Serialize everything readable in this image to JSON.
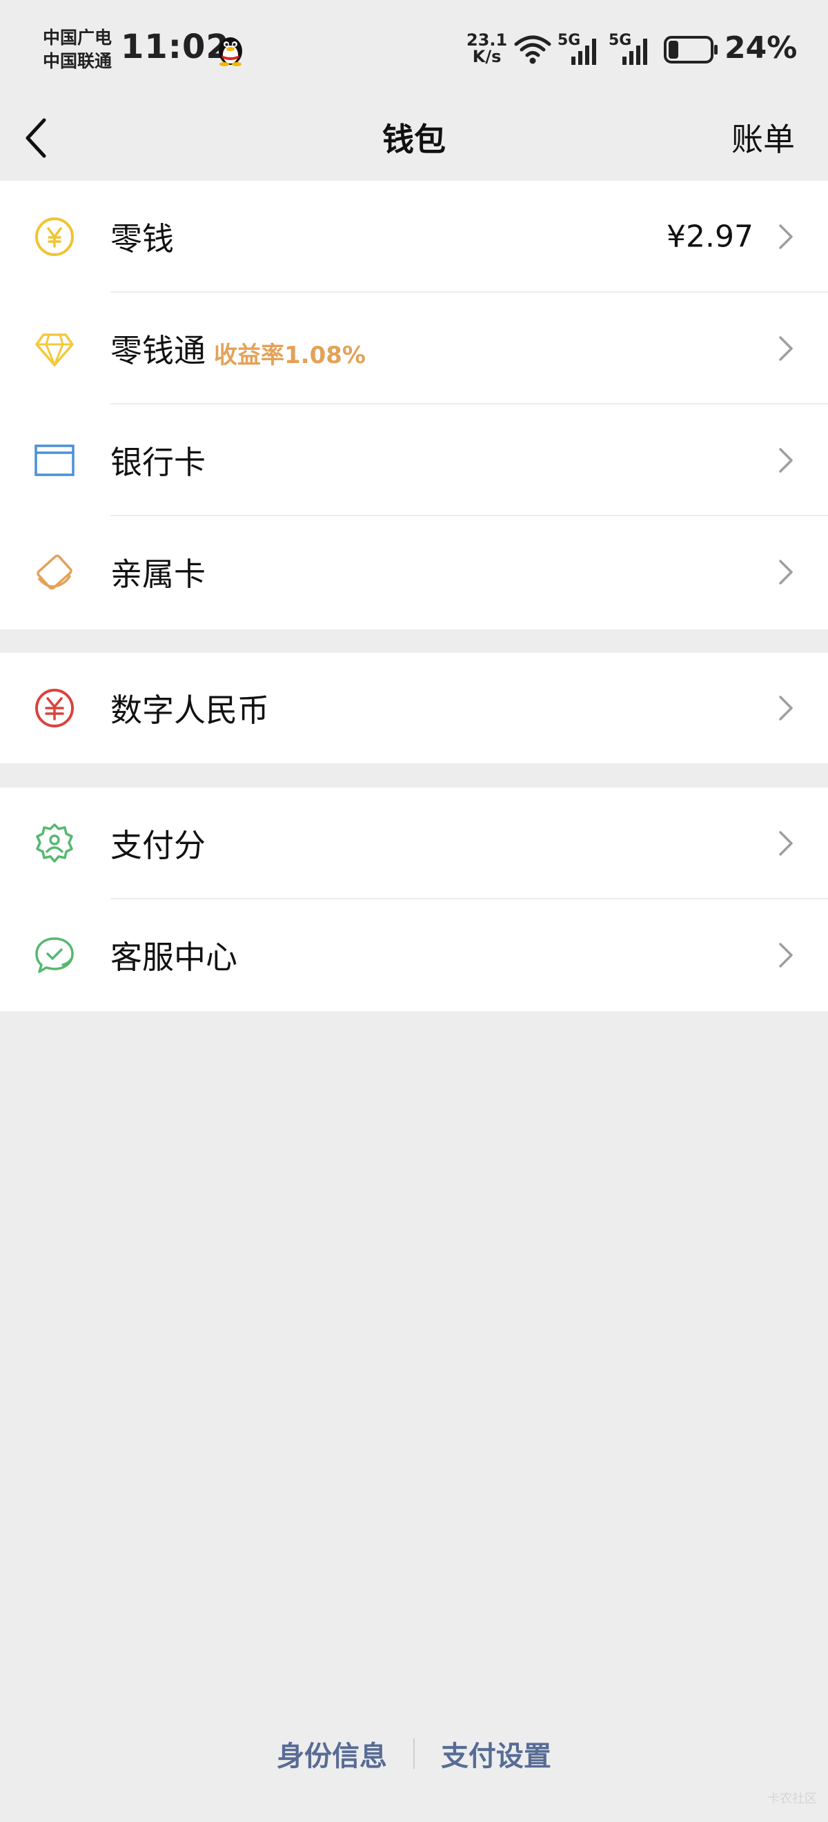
{
  "status_bar": {
    "carrier_1": "中国广电",
    "carrier_2": "中国联通",
    "time": "11:02",
    "net_speed_value": "23.1",
    "net_speed_unit": "K/s",
    "signal_1_label": "5G",
    "signal_2_label": "5G",
    "battery_percent": "24%",
    "battery_level": 0.24
  },
  "nav": {
    "title": "钱包",
    "right_action": "账单"
  },
  "groups": [
    {
      "items": [
        {
          "label": "零钱",
          "value": "¥2.97",
          "icon": "yuan-coin-icon",
          "color": "#F0C431"
        },
        {
          "label": "零钱通",
          "tag": "收益率1.08%",
          "icon": "diamond-icon",
          "color": "#F3C93B"
        },
        {
          "label": "银行卡",
          "icon": "bank-card-icon",
          "color": "#4A90D9"
        },
        {
          "label": "亲属卡",
          "icon": "family-card-icon",
          "color": "#E3A259"
        }
      ]
    },
    {
      "items": [
        {
          "label": "数字人民币",
          "icon": "digital-rmb-icon",
          "color": "#D9433C"
        }
      ]
    },
    {
      "items": [
        {
          "label": "支付分",
          "icon": "pay-score-icon",
          "color": "#56B870"
        },
        {
          "label": "客服中心",
          "icon": "customer-service-icon",
          "color": "#56B870"
        }
      ]
    }
  ],
  "footer": {
    "link_1": "身份信息",
    "link_2": "支付设置"
  },
  "watermark": "卡农社区",
  "colors": {
    "background": "#EDEDED",
    "accent_link": "#576B95",
    "rate_tag": "#E3A259"
  }
}
